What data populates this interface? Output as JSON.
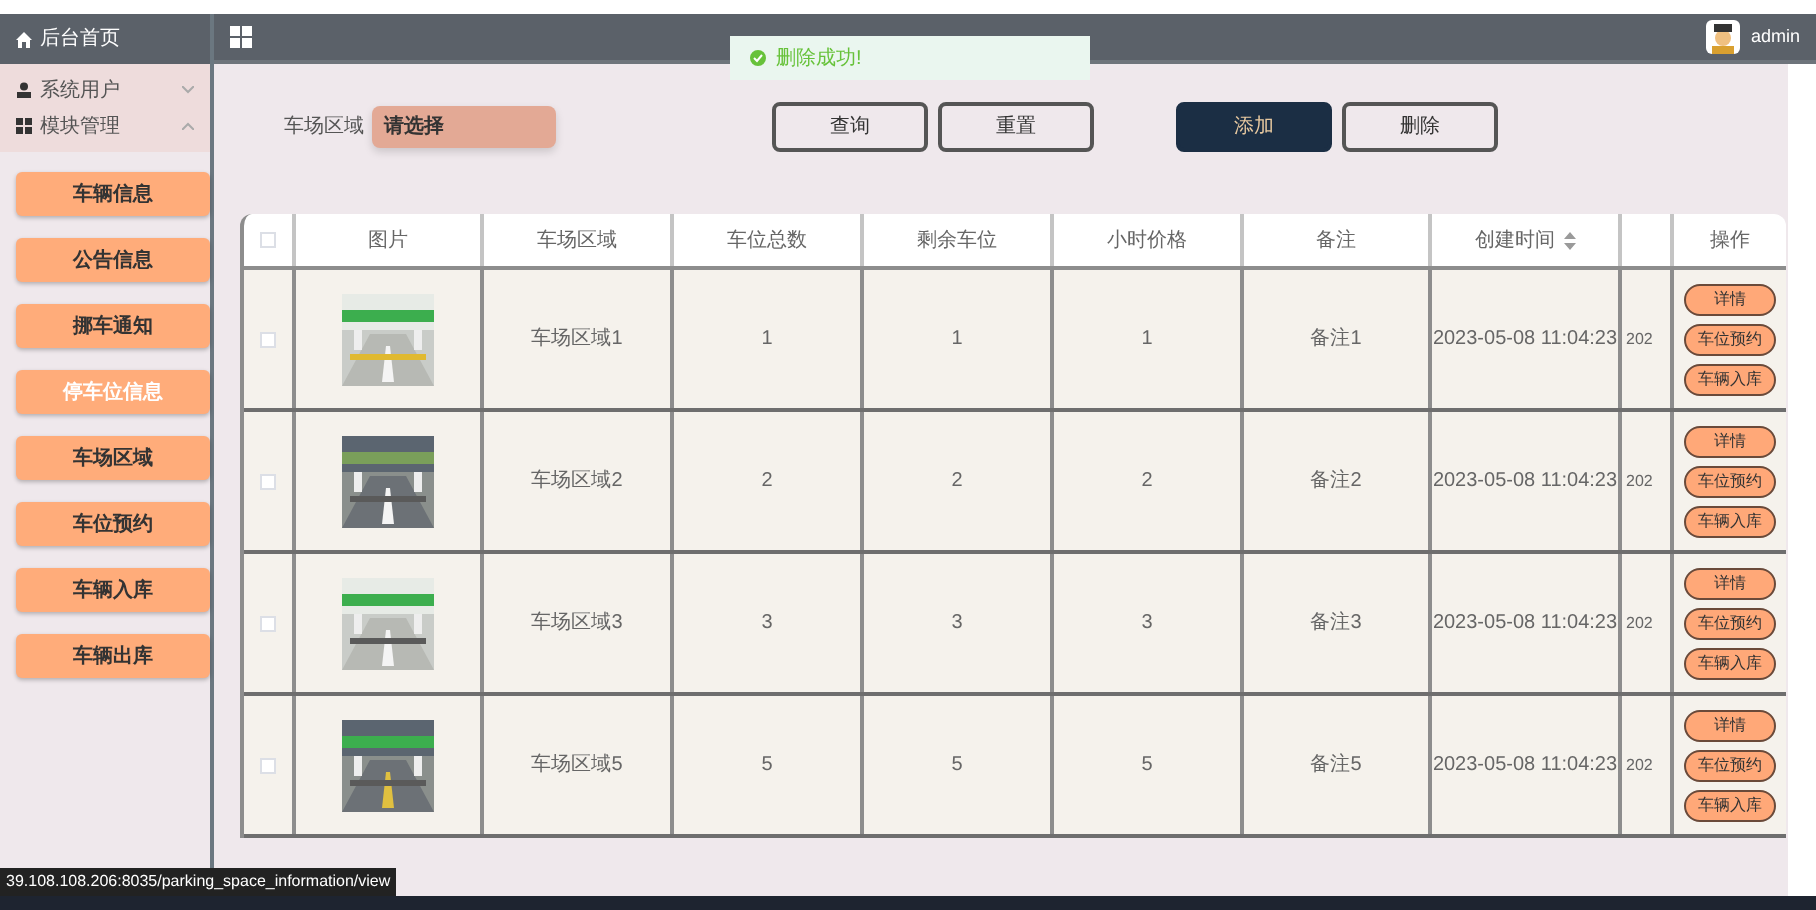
{
  "sidebar": {
    "home": "后台首页",
    "groups": [
      {
        "label": "系统用户",
        "expanded": false
      },
      {
        "label": "模块管理",
        "expanded": true
      }
    ],
    "items": [
      {
        "label": "车辆信息",
        "selected": false
      },
      {
        "label": "公告信息",
        "selected": false
      },
      {
        "label": "挪车通知",
        "selected": false
      },
      {
        "label": "停车位信息",
        "selected": true
      },
      {
        "label": "车场区域",
        "selected": false
      },
      {
        "label": "车位预约",
        "selected": false
      },
      {
        "label": "车辆入库",
        "selected": false
      },
      {
        "label": "车辆出库",
        "selected": false
      }
    ]
  },
  "header": {
    "user": "admin"
  },
  "toast": {
    "message": "删除成功!"
  },
  "filter": {
    "label": "车场区域",
    "placeholder": "请选择"
  },
  "buttons": [
    {
      "label": "查询",
      "kind": "outline"
    },
    {
      "label": "重置",
      "kind": "outline"
    },
    {
      "label": "添加",
      "kind": "primary"
    },
    {
      "label": "删除",
      "kind": "outline"
    }
  ],
  "table": {
    "select_all_checked": false,
    "columns": [
      "图片",
      "车场区域",
      "车位总数",
      "剩余车位",
      "小时价格",
      "备注",
      "创建时间",
      "操作"
    ],
    "rows": [
      {
        "checked": false,
        "region": "车场区域1",
        "total": "1",
        "remaining": "1",
        "price": "1",
        "note": "备注1",
        "created": "2023-05-08 11:04:23",
        "column_9": "202",
        "actions": [
          "详情",
          "车位预约",
          "车辆入库"
        ]
      },
      {
        "checked": false,
        "region": "车场区域2",
        "total": "2",
        "remaining": "2",
        "price": "2",
        "note": "备注2",
        "created": "2023-05-08 11:04:23",
        "column_9": "202",
        "actions": [
          "详情",
          "车位预约",
          "车辆入库"
        ]
      },
      {
        "checked": false,
        "region": "车场区域3",
        "total": "3",
        "remaining": "3",
        "price": "3",
        "note": "备注3",
        "created": "2023-05-08 11:04:23",
        "column_9": "202",
        "actions": [
          "详情",
          "车位预约",
          "车辆入库"
        ]
      },
      {
        "checked": false,
        "region": "车场区域5",
        "total": "5",
        "remaining": "5",
        "price": "5",
        "note": "备注5",
        "created": "2023-05-08 11:04:23",
        "column_9": "202",
        "actions": [
          "详情",
          "车位预约",
          "车辆入库"
        ]
      }
    ]
  },
  "status_url": "39.108.108.206:8035/parking_space_information/view"
}
